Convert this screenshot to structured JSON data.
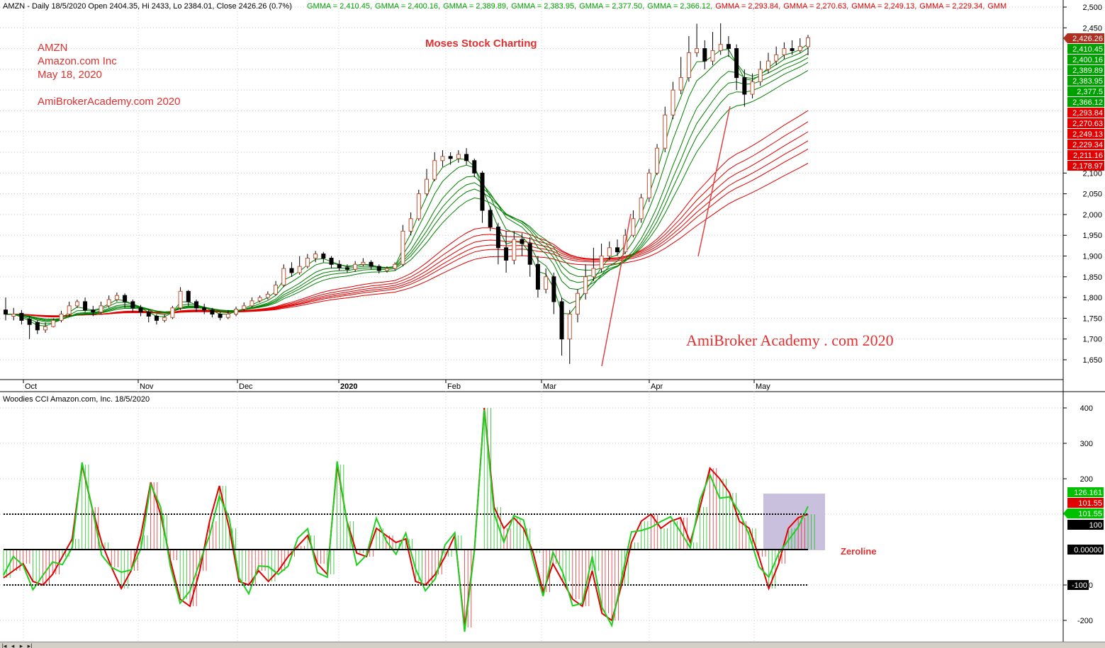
{
  "header": {
    "ticker_line": "AMZN - Daily 18/5/2020 Open 2404.35, Hi 2433, Lo 2384.01, Close 2426.26 (0.7%)",
    "gmma_labels": [
      {
        "text": "GMMA = 2,410.45",
        "color": "#00a000"
      },
      {
        "text": "GMMA = 2,400.16",
        "color": "#00a000"
      },
      {
        "text": "GMMA = 2,389.89",
        "color": "#00a000"
      },
      {
        "text": "GMMA = 2,383.95",
        "color": "#00a000"
      },
      {
        "text": "GMMA = 2,377.50",
        "color": "#00a000"
      },
      {
        "text": "GMMA = 2,366.12",
        "color": "#00a000"
      },
      {
        "text": "GMMA = 2,293.84",
        "color": "#e00000"
      },
      {
        "text": "GMMA = 2,270.63",
        "color": "#e00000"
      },
      {
        "text": "GMMA = 2,249.13",
        "color": "#e00000"
      },
      {
        "text": "GMMA = 2,229.34",
        "color": "#e00000"
      },
      {
        "text": "GMM",
        "color": "#e00000"
      }
    ]
  },
  "annotations": {
    "symbol": "AMZN",
    "company": "Amazon.com Inc",
    "date": "May 18, 2020",
    "site": "AmiBrokerAcademy.com  2020",
    "title": "Moses Stock Charting",
    "watermark": "AmiBroker Academy . com 2020",
    "zeroline": "Zeroline"
  },
  "price_axis": [
    "2,500",
    "2,450",
    "2,100",
    "2,050",
    "2,000",
    "1,950",
    "1,900",
    "1,850",
    "1,800",
    "1,750",
    "1,700",
    "1,650"
  ],
  "price_tags": [
    {
      "text": "2,426.26",
      "color": "#b03020"
    },
    {
      "text": "2,410.45",
      "color": "#00a000"
    },
    {
      "text": "2,400.16",
      "color": "#00a000"
    },
    {
      "text": "2,389.89",
      "color": "#00a000"
    },
    {
      "text": "2,383.95",
      "color": "#00a000"
    },
    {
      "text": "2,377.5",
      "color": "#00a000"
    },
    {
      "text": "2,366.12",
      "color": "#00a000"
    },
    {
      "text": "2,293.84",
      "color": "#e00000"
    },
    {
      "text": "2,270.63",
      "color": "#e00000"
    },
    {
      "text": "2,249.13",
      "color": "#e00000"
    },
    {
      "text": "2,229.34",
      "color": "#e00000"
    },
    {
      "text": "2,211.16",
      "color": "#e00000"
    },
    {
      "text": "2,178.97",
      "color": "#e00000"
    }
  ],
  "months": [
    "Oct",
    "Nov",
    "Dec",
    "2020",
    "Feb",
    "Mar",
    "Apr",
    "May"
  ],
  "cci_panel": {
    "title": "Woodies CCI  Amazon.com, Inc. 18/5/2020",
    "axis": [
      "400",
      "300",
      "200",
      "100",
      "-100",
      "-200"
    ],
    "tags": [
      {
        "text": "126.161",
        "color": "#00c000"
      },
      {
        "text": "101.55",
        "color": "#e00000"
      },
      {
        "text": "101.55",
        "color": "#00c000"
      },
      {
        "text": "100",
        "color": "#000000"
      },
      {
        "text": "0.00000",
        "color": "#000000"
      },
      {
        "text": "-100",
        "color": "#000000"
      }
    ]
  },
  "chart_data": {
    "type": "candlestick",
    "series_candles": [
      [
        1770,
        1760,
        1800,
        1745
      ],
      [
        1755,
        1760,
        1775,
        1745
      ],
      [
        1762,
        1745,
        1770,
        1735
      ],
      [
        1748,
        1735,
        1755,
        1700
      ],
      [
        1740,
        1722,
        1745,
        1712
      ],
      [
        1722,
        1730,
        1740,
        1715
      ],
      [
        1730,
        1745,
        1750,
        1728
      ],
      [
        1745,
        1760,
        1768,
        1740
      ],
      [
        1760,
        1780,
        1790,
        1755
      ],
      [
        1780,
        1790,
        1795,
        1775
      ],
      [
        1790,
        1770,
        1800,
        1765
      ],
      [
        1770,
        1765,
        1780,
        1755
      ],
      [
        1765,
        1780,
        1790,
        1760
      ],
      [
        1780,
        1795,
        1805,
        1775
      ],
      [
        1795,
        1805,
        1812,
        1790
      ],
      [
        1805,
        1790,
        1810,
        1775
      ],
      [
        1790,
        1775,
        1795,
        1765
      ],
      [
        1775,
        1765,
        1782,
        1755
      ],
      [
        1765,
        1755,
        1770,
        1740
      ],
      [
        1755,
        1745,
        1760,
        1735
      ],
      [
        1745,
        1752,
        1760,
        1740
      ],
      [
        1752,
        1775,
        1780,
        1748
      ],
      [
        1775,
        1815,
        1825,
        1770
      ],
      [
        1815,
        1790,
        1818,
        1780
      ],
      [
        1790,
        1775,
        1795,
        1765
      ],
      [
        1775,
        1770,
        1785,
        1760
      ],
      [
        1770,
        1760,
        1775,
        1752
      ],
      [
        1760,
        1752,
        1765,
        1745
      ],
      [
        1752,
        1760,
        1770,
        1748
      ],
      [
        1760,
        1772,
        1778,
        1755
      ],
      [
        1772,
        1780,
        1788,
        1768
      ],
      [
        1780,
        1792,
        1800,
        1776
      ],
      [
        1792,
        1800,
        1805,
        1788
      ],
      [
        1800,
        1808,
        1815,
        1795
      ],
      [
        1808,
        1830,
        1840,
        1805
      ],
      [
        1830,
        1870,
        1880,
        1825
      ],
      [
        1870,
        1860,
        1885,
        1850
      ],
      [
        1860,
        1875,
        1900,
        1855
      ],
      [
        1875,
        1895,
        1905,
        1870
      ],
      [
        1895,
        1905,
        1912,
        1885
      ],
      [
        1905,
        1895,
        1910,
        1885
      ],
      [
        1895,
        1880,
        1900,
        1870
      ],
      [
        1880,
        1872,
        1890,
        1865
      ],
      [
        1872,
        1868,
        1880,
        1860
      ],
      [
        1868,
        1880,
        1888,
        1862
      ],
      [
        1880,
        1885,
        1895,
        1875
      ],
      [
        1885,
        1875,
        1890,
        1868
      ],
      [
        1875,
        1865,
        1880,
        1858
      ],
      [
        1865,
        1870,
        1875,
        1860
      ],
      [
        1870,
        1880,
        1885,
        1865
      ],
      [
        1880,
        1960,
        1975,
        1875
      ],
      [
        1960,
        1990,
        2005,
        1950
      ],
      [
        1990,
        2050,
        2060,
        1985
      ],
      [
        2050,
        2085,
        2110,
        2045
      ],
      [
        2085,
        2130,
        2150,
        2080
      ],
      [
        2130,
        2140,
        2155,
        2115
      ],
      [
        2140,
        2135,
        2150,
        2120
      ],
      [
        2135,
        2145,
        2155,
        2125
      ],
      [
        2145,
        2130,
        2160,
        2120
      ],
      [
        2130,
        2100,
        2135,
        2090
      ],
      [
        2100,
        2010,
        2105,
        1980
      ],
      [
        2010,
        1970,
        2020,
        1960
      ],
      [
        1970,
        1920,
        1980,
        1880
      ],
      [
        1920,
        1890,
        1960,
        1860
      ],
      [
        1890,
        1940,
        1960,
        1880
      ],
      [
        1940,
        1930,
        1955,
        1900
      ],
      [
        1930,
        1880,
        1945,
        1850
      ],
      [
        1880,
        1820,
        1900,
        1800
      ],
      [
        1820,
        1850,
        1870,
        1810
      ],
      [
        1850,
        1790,
        1860,
        1760
      ],
      [
        1790,
        1700,
        1800,
        1660
      ],
      [
        1700,
        1760,
        1770,
        1640
      ],
      [
        1760,
        1810,
        1820,
        1740
      ],
      [
        1810,
        1850,
        1880,
        1795
      ],
      [
        1850,
        1870,
        1920,
        1840
      ],
      [
        1870,
        1900,
        1930,
        1860
      ],
      [
        1900,
        1920,
        1935,
        1890
      ],
      [
        1920,
        1910,
        1940,
        1900
      ],
      [
        1910,
        1950,
        1965,
        1905
      ],
      [
        1950,
        1990,
        2010,
        1945
      ],
      [
        1990,
        2040,
        2050,
        1980
      ],
      [
        2040,
        2100,
        2110,
        2030
      ],
      [
        2100,
        2160,
        2170,
        2095
      ],
      [
        2160,
        2240,
        2260,
        2150
      ],
      [
        2240,
        2300,
        2320,
        2230
      ],
      [
        2300,
        2330,
        2380,
        2290
      ],
      [
        2330,
        2390,
        2430,
        2320
      ],
      [
        2390,
        2400,
        2460,
        2380
      ],
      [
        2400,
        2370,
        2420,
        2350
      ],
      [
        2370,
        2395,
        2440,
        2360
      ],
      [
        2395,
        2410,
        2461,
        2385
      ],
      [
        2410,
        2400,
        2430,
        2380
      ],
      [
        2400,
        2330,
        2410,
        2300
      ],
      [
        2330,
        2290,
        2350,
        2260
      ],
      [
        2290,
        2320,
        2340,
        2280
      ],
      [
        2320,
        2350,
        2370,
        2310
      ],
      [
        2350,
        2370,
        2390,
        2340
      ],
      [
        2370,
        2385,
        2405,
        2360
      ],
      [
        2385,
        2400,
        2415,
        2375
      ],
      [
        2400,
        2395,
        2420,
        2385
      ],
      [
        2395,
        2405,
        2425,
        2390
      ],
      [
        2404.35,
        2426.26,
        2433,
        2384.01
      ]
    ],
    "cci": [
      -80,
      -60,
      -40,
      -90,
      -100,
      -70,
      -20,
      30,
      240,
      120,
      20,
      -50,
      -110,
      -60,
      40,
      190,
      100,
      -30,
      -140,
      -160,
      -60,
      80,
      180,
      60,
      -90,
      -100,
      -60,
      -90,
      -60,
      -20,
      10,
      40,
      -40,
      -70,
      240,
      80,
      -10,
      -20,
      60,
      40,
      20,
      30,
      -90,
      -100,
      -70,
      -20,
      40,
      -220,
      0,
      400,
      120,
      60,
      90,
      60,
      -10,
      -120,
      -40,
      -90,
      -140,
      -160,
      -60,
      -180,
      -200,
      -100,
      20,
      80,
      100,
      60,
      80,
      90,
      20,
      120,
      230,
      200,
      160,
      80,
      60,
      -20,
      -110,
      -40,
      60,
      90,
      100
    ]
  }
}
